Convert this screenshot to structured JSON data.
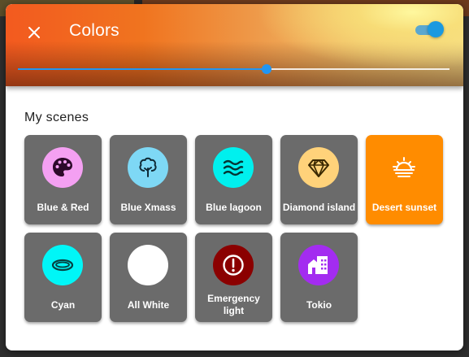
{
  "dialog": {
    "title": "Colors",
    "toggle_on": true,
    "slider_value": 0.577,
    "colors": {
      "accent": "#2196f3",
      "tile_bg": "#6b6b6b",
      "tile_active_bg": "#ff8c00"
    }
  },
  "scenes_section": {
    "title": "My scenes",
    "items": [
      {
        "label": "Blue & Red",
        "icon": "palette-icon",
        "icon_bg": "#f4a0f2",
        "icon_color": "#2d0a2b",
        "active": false
      },
      {
        "label": "Blue Xmass",
        "icon": "tree-icon",
        "icon_bg": "#7ed8f5",
        "icon_color": "#0f2a36",
        "active": false
      },
      {
        "label": "Blue lagoon",
        "icon": "waves-icon",
        "icon_bg": "#00f0ee",
        "icon_color": "#043534",
        "active": false
      },
      {
        "label": "Diamond island",
        "icon": "diamond-icon",
        "icon_bg": "#ffd27a",
        "icon_color": "#3a2800",
        "active": false
      },
      {
        "label": "Desert sunset",
        "icon": "sunset-icon",
        "icon_bg": "#ff8c00",
        "icon_color": "#ffffff",
        "active": true
      },
      {
        "label": "Cyan",
        "icon": "ellipse-icon",
        "icon_bg": "#00f6f7",
        "icon_color": "#064040",
        "active": false
      },
      {
        "label": "All White",
        "icon": "blank-icon",
        "icon_bg": "#ffffff",
        "icon_color": "#ffffff",
        "active": false
      },
      {
        "label": "Emergency light",
        "icon": "alert-icon",
        "icon_bg": "#8b0000",
        "icon_color": "#ffffff",
        "active": false
      },
      {
        "label": "Tokio",
        "icon": "city-icon",
        "icon_bg": "#a32cf0",
        "icon_color": "#ffffff",
        "active": false
      }
    ]
  }
}
